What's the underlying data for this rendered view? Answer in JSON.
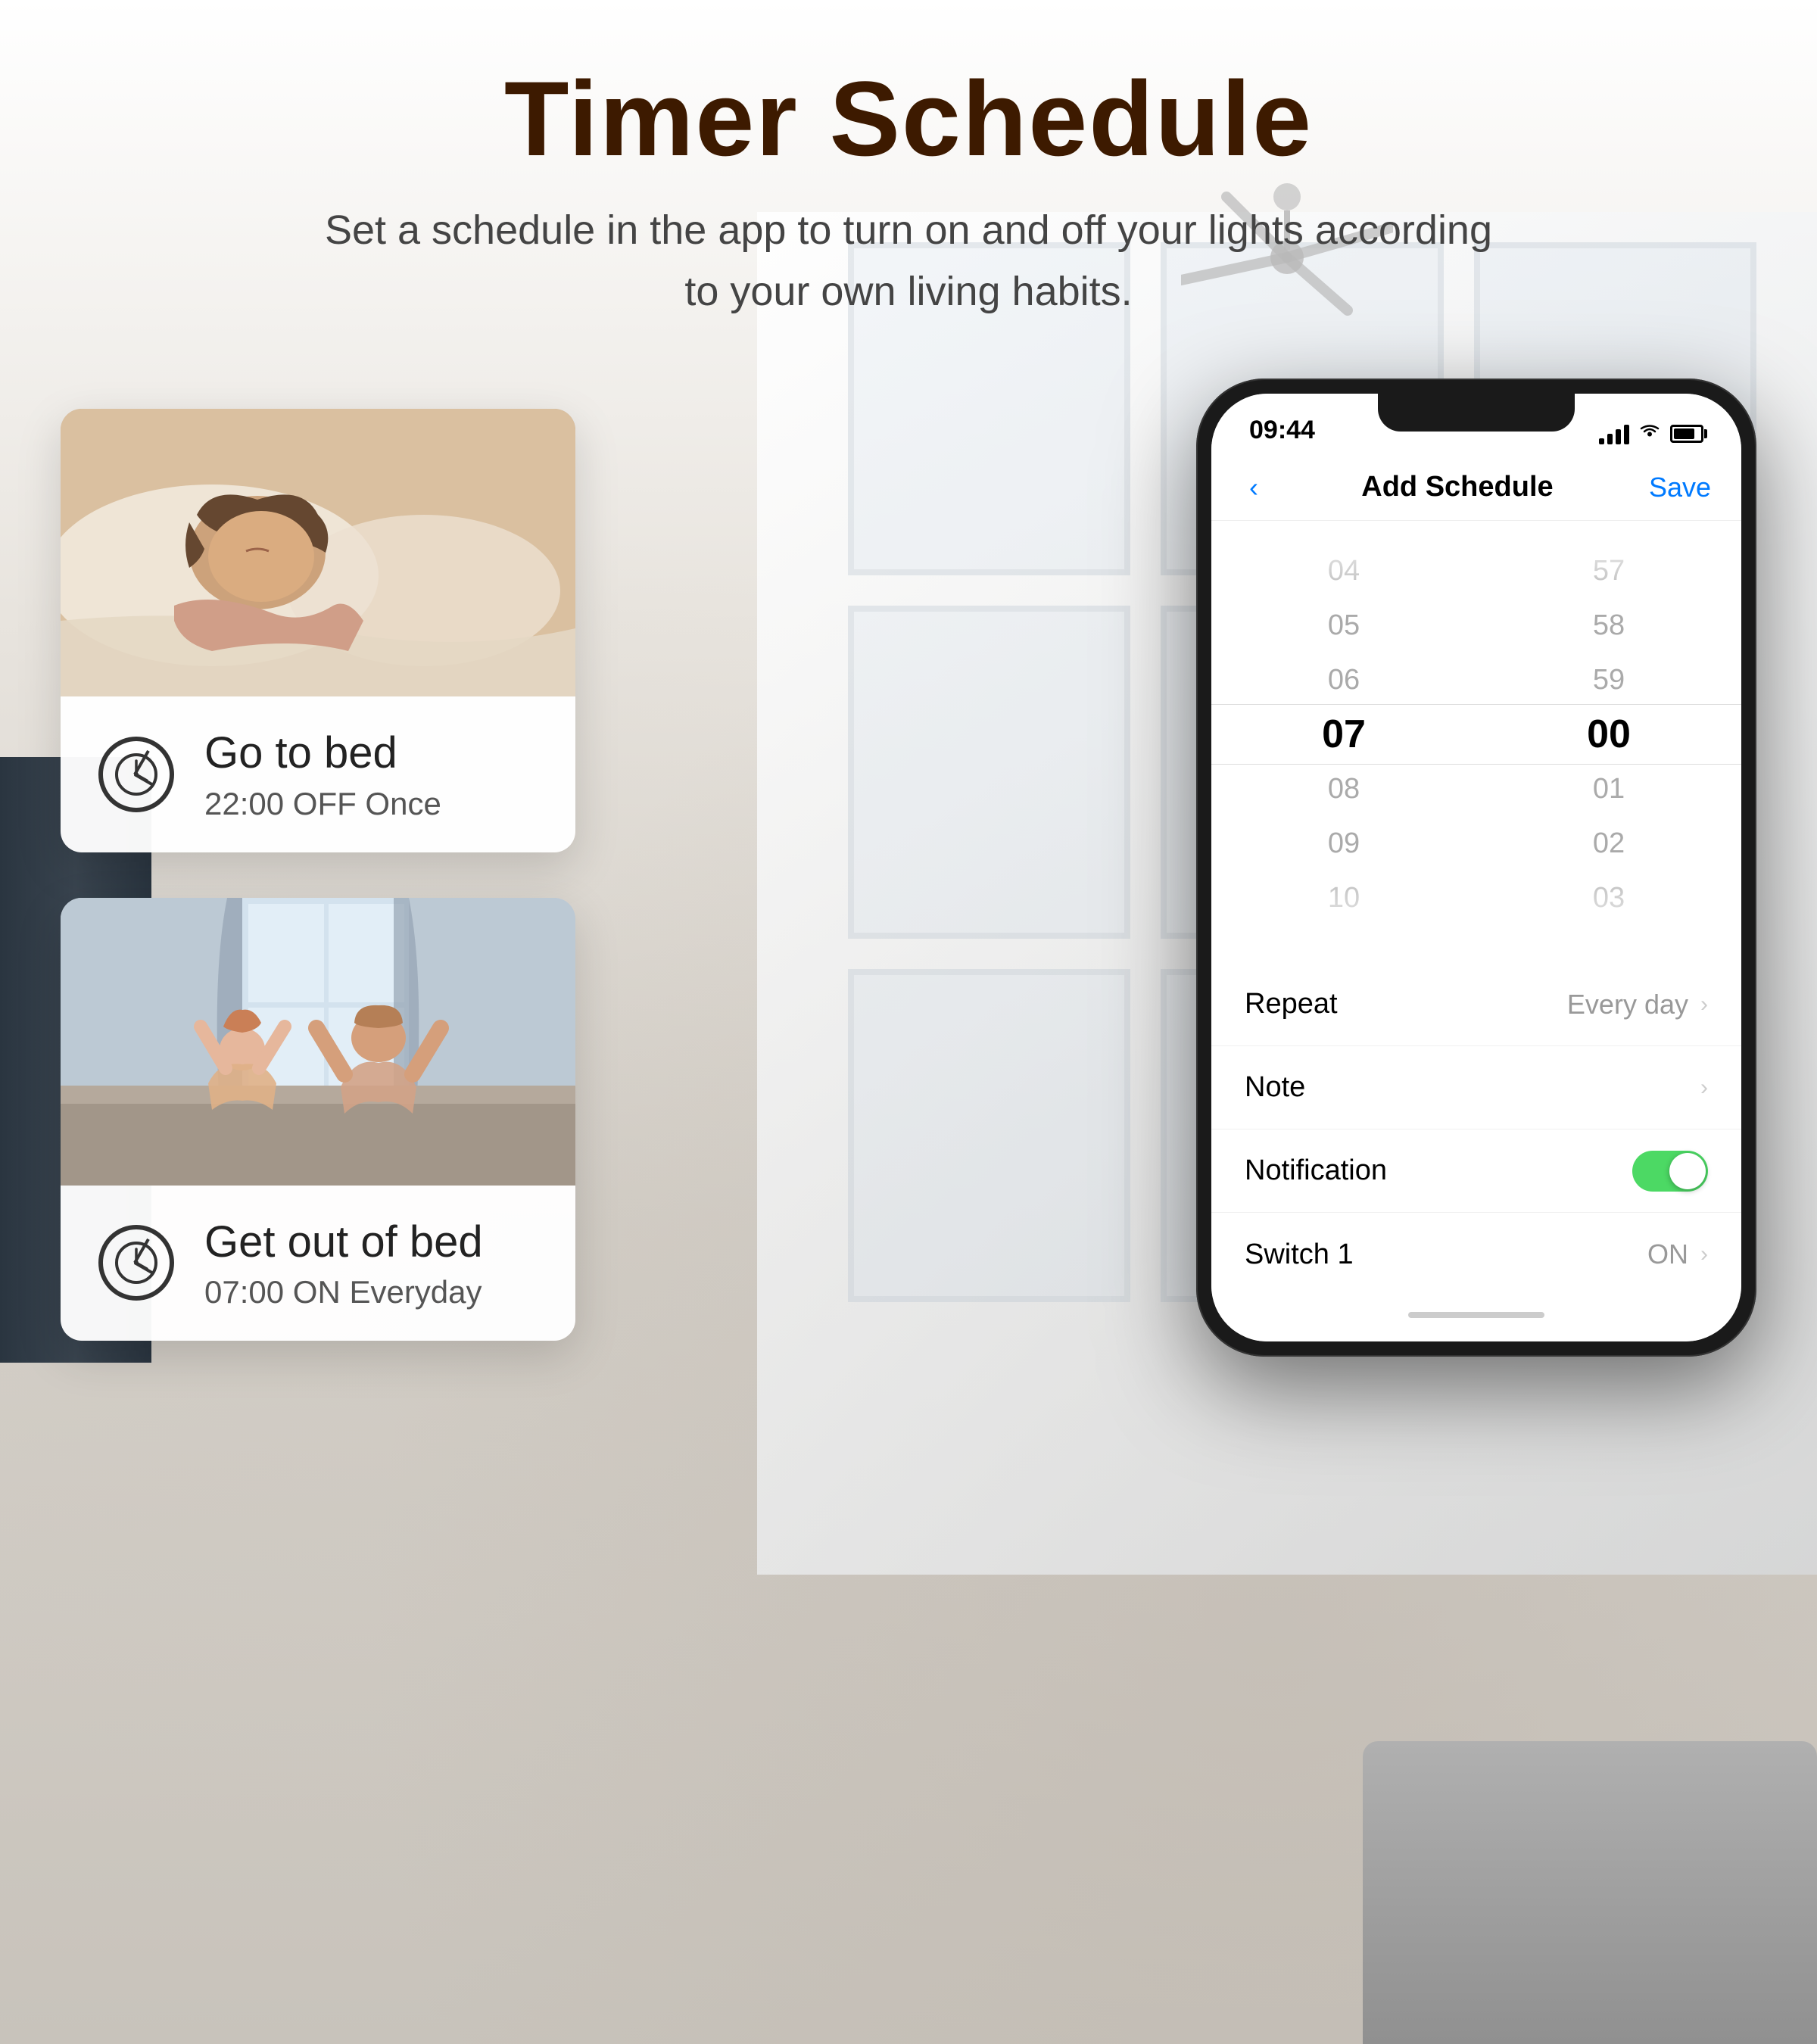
{
  "page": {
    "title": "Timer Schedule",
    "subtitle": "Set a schedule in the app to turn on and off your lights according to your own living habits."
  },
  "cards": [
    {
      "id": "sleep-card",
      "title": "Go to bed",
      "detail": "22:00 OFF Once",
      "image_alt": "Woman sleeping in bed"
    },
    {
      "id": "wake-card",
      "title": "Get out of bed",
      "detail": "07:00 ON Everyday",
      "image_alt": "Couple stretching in bed morning"
    }
  ],
  "phone": {
    "status_bar": {
      "time": "09:44",
      "signal": "●●●",
      "wifi": "WiFi",
      "battery": "Battery"
    },
    "nav": {
      "back_label": "‹",
      "title": "Add Schedule",
      "save_label": "Save"
    },
    "time_picker": {
      "hours": [
        "04",
        "05",
        "06",
        "07",
        "08",
        "09",
        "10"
      ],
      "minutes": [
        "57",
        "58",
        "59",
        "00",
        "01",
        "02",
        "03"
      ],
      "selected_hour": "07",
      "selected_minute": "00"
    },
    "settings": [
      {
        "id": "repeat",
        "label": "Repeat",
        "value": "Every day",
        "type": "chevron"
      },
      {
        "id": "note",
        "label": "Note",
        "value": "",
        "type": "chevron"
      },
      {
        "id": "notification",
        "label": "Notification",
        "value": "",
        "type": "toggle",
        "toggle_state": true
      },
      {
        "id": "switch1",
        "label": "Switch 1",
        "value": "ON",
        "type": "chevron"
      }
    ]
  },
  "icons": {
    "back": "‹",
    "chevron_right": "›",
    "clock": "🕐"
  }
}
